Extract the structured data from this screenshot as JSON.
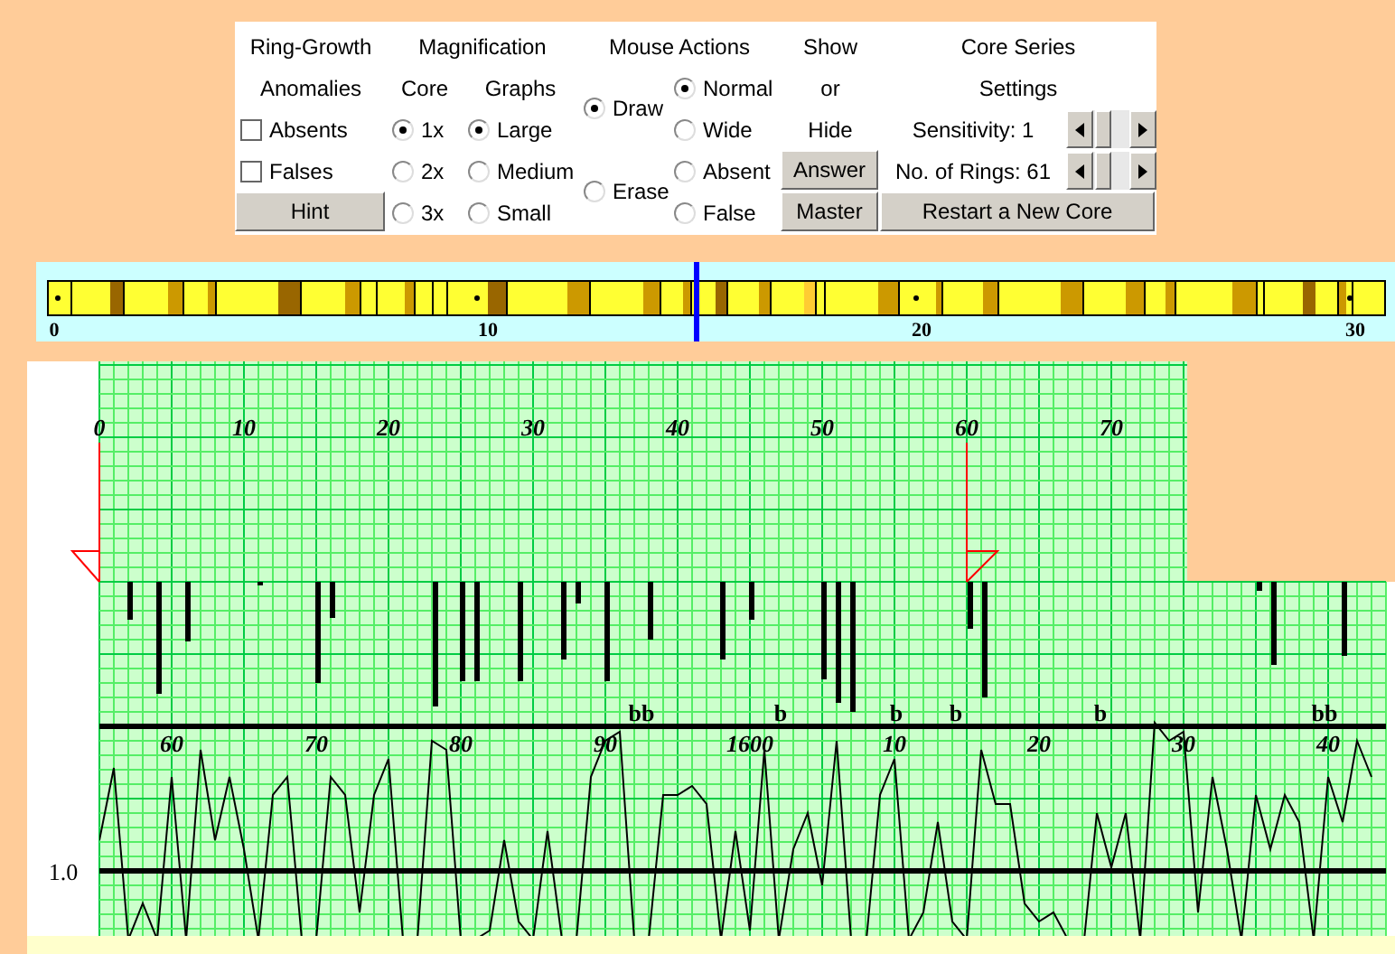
{
  "anomalies": {
    "heading": [
      "Ring-Growth",
      "Anomalies"
    ],
    "checkboxes": [
      {
        "label": "Absents",
        "checked": false
      },
      {
        "label": "Falses",
        "checked": false
      }
    ],
    "hint_button": "Hint"
  },
  "magnification": {
    "heading": "Magnification",
    "core": {
      "heading": "Core",
      "options": [
        {
          "label": "1x",
          "selected": true
        },
        {
          "label": "2x",
          "selected": false
        },
        {
          "label": "3x",
          "selected": false
        }
      ]
    },
    "graphs": {
      "heading": "Graphs",
      "options": [
        {
          "label": "Large",
          "selected": true
        },
        {
          "label": "Medium",
          "selected": false
        },
        {
          "label": "Small",
          "selected": false
        }
      ]
    }
  },
  "mouse_actions": {
    "heading": "Mouse Actions",
    "modes": [
      {
        "label": "Draw",
        "selected": true
      },
      {
        "label": "Erase",
        "selected": false
      }
    ],
    "types": [
      {
        "label": "Normal",
        "selected": true
      },
      {
        "label": "Wide",
        "selected": false
      },
      {
        "label": "Absent",
        "selected": false
      },
      {
        "label": "False",
        "selected": false
      }
    ]
  },
  "show": {
    "heading": [
      "Show",
      "or",
      "Hide"
    ],
    "buttons": [
      "Answer",
      "Master"
    ]
  },
  "core_series": {
    "heading": [
      "Core Series",
      "Settings"
    ],
    "sliders": [
      {
        "label": "Sensitivity: 1"
      },
      {
        "label": "No. of Rings: 61"
      }
    ],
    "restart_button": "Restart a New Core"
  },
  "core_strip": {
    "year_labels": [
      "0",
      "10",
      "20",
      "30"
    ]
  },
  "top_graph": {
    "year_labels": [
      "0",
      "10",
      "20",
      "30",
      "40",
      "50",
      "60",
      "70"
    ]
  },
  "bottom_graph": {
    "marker_labels": [
      "bb",
      "b",
      "b",
      "b",
      "b",
      "bb"
    ],
    "year_labels": [
      "60",
      "70",
      "80",
      "90",
      "1600",
      "10",
      "20",
      "30",
      "40"
    ],
    "y_label": "1.0"
  }
}
